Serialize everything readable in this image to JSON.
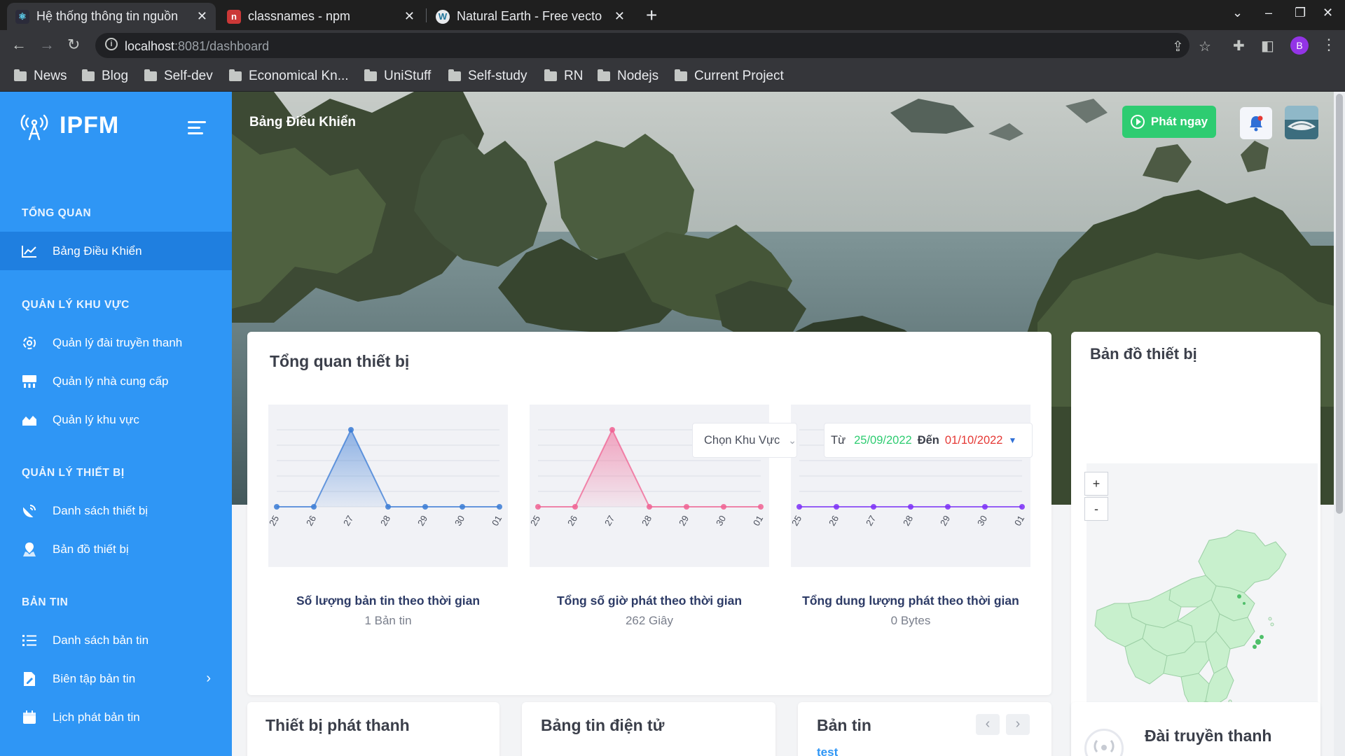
{
  "browser": {
    "tabs": [
      {
        "title": "Hệ thống thông tin nguồn"
      },
      {
        "title": "classnames - npm"
      },
      {
        "title": "Natural Earth - Free vecto"
      }
    ],
    "url_host": "localhost",
    "url_path": ":8081/dashboard",
    "profile_initial": "B",
    "bookmarks": [
      "News",
      "Blog",
      "Self-dev",
      "Economical Kn...",
      "UniStuff",
      "Self-study",
      "RN",
      "Nodejs",
      "Current Project"
    ]
  },
  "sidebar": {
    "brand": "IPFM",
    "sections": [
      {
        "title": "TỔNG QUAN",
        "items": [
          {
            "label": "Bảng Điều Khiển",
            "icon": "chart-line-icon",
            "active": true
          }
        ]
      },
      {
        "title": "QUẢN LÝ KHU VỰC",
        "items": [
          {
            "label": "Quản lý đài truyền thanh",
            "icon": "radio-station-icon"
          },
          {
            "label": "Quản lý nhà cung cấp",
            "icon": "provider-icon"
          },
          {
            "label": "Quản lý khu vực",
            "icon": "area-chart-icon"
          }
        ]
      },
      {
        "title": "QUẢN LÝ THIẾT BỊ",
        "items": [
          {
            "label": "Danh sách thiết bị",
            "icon": "satellite-dish-icon"
          },
          {
            "label": "Bản đồ thiết bị",
            "icon": "map-marker-icon"
          }
        ]
      },
      {
        "title": "BẢN TIN",
        "items": [
          {
            "label": "Danh sách bản tin",
            "icon": "list-icon"
          },
          {
            "label": "Biên tập bản tin",
            "icon": "edit-document-icon",
            "has_submenu": true
          },
          {
            "label": "Lịch phát bản tin",
            "icon": "calendar-icon"
          }
        ]
      }
    ]
  },
  "header": {
    "page_title": "Bảng Điều Khiển",
    "broadcast_button": "Phát ngay"
  },
  "overview": {
    "title": "Tổng quan thiết bị",
    "area_select": "Chọn Khu Vực",
    "date_from_label": "Từ",
    "date_from": "25/09/2022",
    "date_to_label": "Đến",
    "date_to": "01/10/2022",
    "charts": [
      {
        "caption": "Số lượng bản tin theo thời gian",
        "summary": "1 Bản tin"
      },
      {
        "caption": "Tổng số giờ phát theo thời gian",
        "summary": "262 Giây"
      },
      {
        "caption": "Tổng dung lượng phát theo thời gian",
        "summary": "0 Bytes"
      }
    ]
  },
  "chart_data": [
    {
      "type": "area",
      "categories": [
        "25",
        "26",
        "27",
        "28",
        "29",
        "30",
        "01"
      ],
      "values": [
        0,
        0,
        1,
        0,
        0,
        0,
        0
      ],
      "color": "#3a7bd5"
    },
    {
      "type": "area",
      "categories": [
        "25",
        "26",
        "27",
        "28",
        "29",
        "30",
        "01"
      ],
      "values": [
        0,
        0,
        262,
        0,
        0,
        0,
        0
      ],
      "color": "#f06292"
    },
    {
      "type": "line",
      "categories": [
        "25",
        "26",
        "27",
        "28",
        "29",
        "30",
        "01"
      ],
      "values": [
        0,
        0,
        0,
        0,
        0,
        0,
        0
      ],
      "color": "#7b2ff7"
    }
  ],
  "map_card": {
    "title": "Bản đồ thiết bị",
    "zoom_in": "+",
    "zoom_out": "-",
    "legend_colors": [
      "#d9f5dd",
      "#bfeac7",
      "#9fe0ad",
      "#6fd08a",
      "#3cb863"
    ]
  },
  "bottom_cards": {
    "devices": "Thiết bị phát thanh",
    "e_board": "Bảng tin điện tử",
    "news": "Bản tin",
    "news_first": "test",
    "stations": "Đài truyền thanh"
  },
  "colors": {
    "sidebar": "#2f96f5",
    "accent_green": "#2ecc71",
    "date_from": "#2ecc71",
    "date_to": "#e53935"
  }
}
